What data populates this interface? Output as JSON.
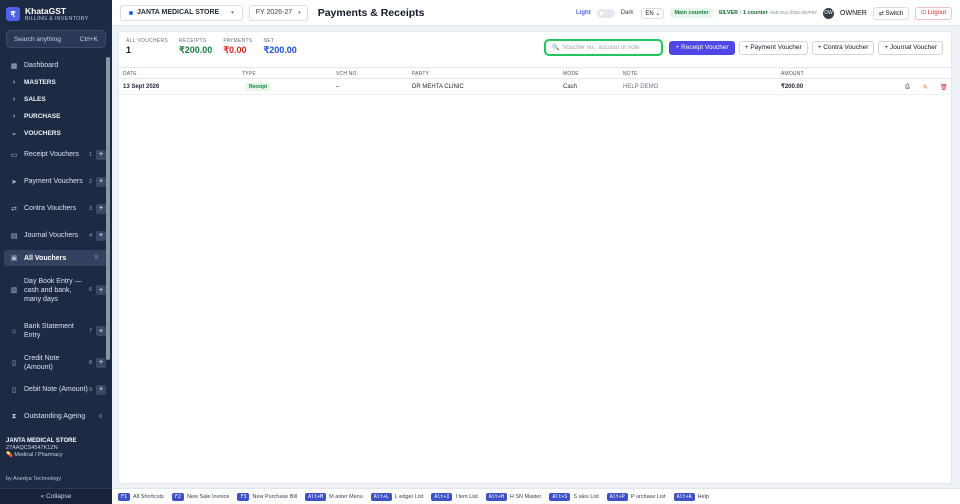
{
  "brand": {
    "logo": "₹",
    "name": "KhataGST",
    "sub": "BILLING & INVENTORY"
  },
  "sidebar": {
    "search_label": "Search anything",
    "search_shortcut": "Ctrl+K",
    "items": [
      {
        "label": "Dashboard",
        "icon": "grid-icon"
      },
      {
        "label": "MASTERS",
        "icon": "chevron-right-icon"
      },
      {
        "label": "SALES",
        "icon": "chevron-right-icon"
      },
      {
        "label": "PURCHASE",
        "icon": "chevron-right-icon"
      },
      {
        "label": "VOUCHERS",
        "icon": "chevron-down-icon"
      },
      {
        "label": "Receipt Vouchers",
        "num": "1"
      },
      {
        "label": "Payment Vouchers",
        "num": "2"
      },
      {
        "label": "Contra Vouchers",
        "num": "3"
      },
      {
        "label": "Journal Vouchers",
        "num": "4"
      },
      {
        "label": "All Vouchers",
        "num": "5"
      },
      {
        "label": "Day Book Entry — cash and bank, many days",
        "num": "6"
      },
      {
        "label": "Bank Statement Entry",
        "num": "7"
      },
      {
        "label": "Credit Note (Amount)",
        "num": "8"
      },
      {
        "label": "Debit Note (Amount)",
        "num": "9"
      },
      {
        "label": "Outstanding Ageing",
        "num": "0"
      }
    ],
    "store_name": "JANTA MEDICAL STORE",
    "gstin": "27AAQCS4547K1ZN",
    "category": "Medical / Pharmacy",
    "by": "by Anedya Technology",
    "collapse": "« Collapse"
  },
  "topbar": {
    "store": "JANTA MEDICAL STORE",
    "fy": "FY 2026-27",
    "title": "Payments & Receipts",
    "light": "Light",
    "dark": "Dark",
    "lang": "EN",
    "counter": "Main counter",
    "plan": "SILVER · 1 counter",
    "plan_code": "AND-SLV-2026-4E7F97",
    "avatar": "OW",
    "role": "OWNER",
    "switch": "⇄ Switch",
    "logout": "⏻ Logout"
  },
  "stats": {
    "all_label": "ALL VOUCHERS",
    "all": "1",
    "rec_label": "RECEIPTS",
    "rec": "₹200.00",
    "pay_label": "PAYMENTS",
    "pay": "₹0.00",
    "net_label": "NET",
    "net": "₹200.00"
  },
  "actions": {
    "search_placeholder": "Voucher no., account or note",
    "receipt": "+ Receipt Voucher",
    "payment": "+ Payment Voucher",
    "contra": "+ Contra Voucher",
    "journal": "+ Journal Voucher"
  },
  "table": {
    "headers": [
      "DATE",
      "TYPE",
      "VCH NO.",
      "PARTY",
      "MODE",
      "NOTE",
      "AMOUNT"
    ],
    "rows": [
      {
        "date": "13 Sept 2026",
        "type": "Receipt",
        "vch": "–",
        "party": "DR MEHTA CLINIC",
        "mode": "Cash",
        "note": "HELP DEMO",
        "amount": "₹200.00"
      }
    ]
  },
  "footer": [
    {
      "key": "F1",
      "label": "All Shortcuts"
    },
    {
      "key": "F2",
      "label": "New Sale Invoice"
    },
    {
      "key": "F3",
      "label": "New Purchase Bill"
    },
    {
      "key": "Alt+M",
      "label": "M aster Menu"
    },
    {
      "key": "Alt+L",
      "label": "L edger List"
    },
    {
      "key": "Alt+I",
      "label": "I tem List"
    },
    {
      "key": "Alt+H",
      "label": "H SN Master"
    },
    {
      "key": "Alt+S",
      "label": "S ales List"
    },
    {
      "key": "Alt+P",
      "label": "P urchase List"
    },
    {
      "key": "Alt+A",
      "label": "Help"
    }
  ]
}
